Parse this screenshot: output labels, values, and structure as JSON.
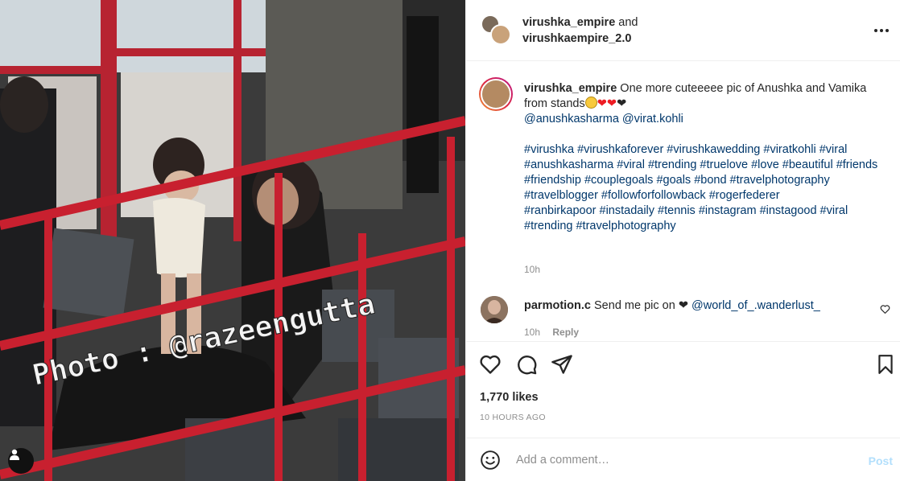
{
  "media": {
    "watermark": "Photo : @razeengutta",
    "user_tag_icon": "user-tag-icon"
  },
  "header": {
    "user1": "virushka_empire",
    "connector": "and",
    "user2": "virushkaempire_2.0",
    "more_icon": "more-options-icon"
  },
  "caption": {
    "username": "virushka_empire",
    "text": "One more cuteeeee pic of Anushka and Vamika from stands",
    "mentions": [
      "@anushkasharma",
      "@virat.kohli"
    ],
    "hashtags_block1": "#virushka #virushkaforever #virushkawedding #viratkohli #viral #anushkasharma #viral #trending #truelove #love #beautiful #friends #friendship #couplegoals #goals #bond #travelphotography #travelblogger #followforfollowback #rogerfederer",
    "hashtags_block2": "#ranbirkapoor #instadaily #tennis #instagram #instagood #viral #trending #travelphotography",
    "time": "10h"
  },
  "comment": {
    "username": "parmotion.c",
    "text": "Send me pic on",
    "mention": "@world_of_.wanderlust_",
    "time": "10h",
    "reply_label": "Reply"
  },
  "stats": {
    "likes": "1,770 likes",
    "date": "10 HOURS AGO"
  },
  "comment_bar": {
    "placeholder": "Add a comment…",
    "post_label": "Post"
  },
  "colors": {
    "link": "#00376b",
    "muted": "#8e8e8e",
    "post_disabled": "#b2dffc",
    "railing": "#c8202f"
  }
}
